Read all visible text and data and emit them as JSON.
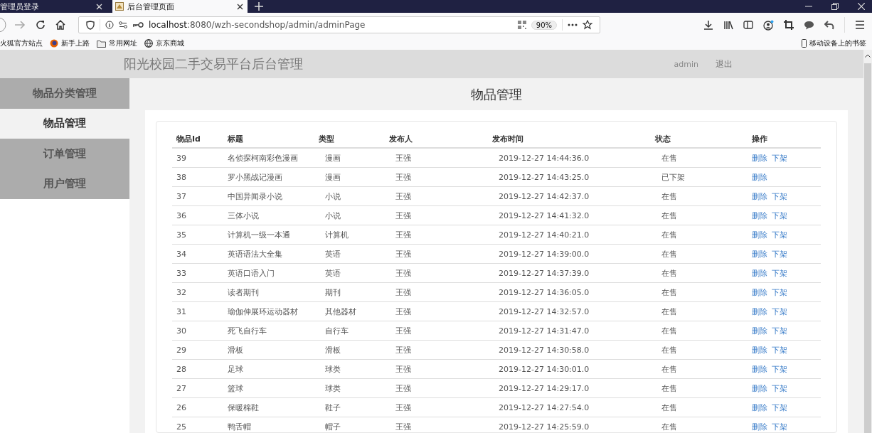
{
  "browser": {
    "tabs": [
      {
        "label": "管理员登录",
        "selected": false
      },
      {
        "label": "后台管理页面",
        "selected": true
      }
    ],
    "url": {
      "host": "localhost",
      "rest": ":8080/wzh-secondshop/admin/adminPage"
    },
    "zoom": "90%",
    "bookmarks": [
      "火狐官方站点",
      "新手上路",
      "常用网址",
      "京东商城"
    ],
    "mobile_bookmarks": "移动设备上的书签"
  },
  "header": {
    "title": "阳光校园二手交易平台后台管理",
    "user": "admin",
    "logout": "退出"
  },
  "sidebar": {
    "items": [
      {
        "label": "物品分类管理",
        "selected": false
      },
      {
        "label": "物品管理",
        "selected": true
      },
      {
        "label": "订单管理",
        "selected": false
      },
      {
        "label": "用户管理",
        "selected": false
      }
    ]
  },
  "page_title": "物品管理",
  "table": {
    "columns": [
      "物品Id",
      "标题",
      "类型",
      "发布人",
      "发布时间",
      "状态",
      "操作"
    ],
    "rows": [
      {
        "id": "39",
        "title": "名侦探柯南彩色漫画",
        "type": "漫画",
        "publisher": "王强",
        "time": "2019-12-27 14:44:36.0",
        "status": "在售",
        "actions": [
          "删除",
          "下架"
        ]
      },
      {
        "id": "38",
        "title": "罗小黑战记漫画",
        "type": "漫画",
        "publisher": "王强",
        "time": "2019-12-27 14:43:25.0",
        "status": "已下架",
        "actions": [
          "删除"
        ]
      },
      {
        "id": "37",
        "title": "中国异闻录小说",
        "type": "小说",
        "publisher": "王强",
        "time": "2019-12-27 14:42:37.0",
        "status": "在售",
        "actions": [
          "删除",
          "下架"
        ]
      },
      {
        "id": "36",
        "title": "三体小说",
        "type": "小说",
        "publisher": "王强",
        "time": "2019-12-27 14:41:32.0",
        "status": "在售",
        "actions": [
          "删除",
          "下架"
        ]
      },
      {
        "id": "35",
        "title": "计算机一级一本通",
        "type": "计算机",
        "publisher": "王强",
        "time": "2019-12-27 14:40:21.0",
        "status": "在售",
        "actions": [
          "删除",
          "下架"
        ]
      },
      {
        "id": "34",
        "title": "英语语法大全集",
        "type": "英语",
        "publisher": "王强",
        "time": "2019-12-27 14:39:00.0",
        "status": "在售",
        "actions": [
          "删除",
          "下架"
        ]
      },
      {
        "id": "33",
        "title": "英语口语入门",
        "type": "英语",
        "publisher": "王强",
        "time": "2019-12-27 14:37:39.0",
        "status": "在售",
        "actions": [
          "删除",
          "下架"
        ]
      },
      {
        "id": "32",
        "title": "读者期刊",
        "type": "期刊",
        "publisher": "王强",
        "time": "2019-12-27 14:36:05.0",
        "status": "在售",
        "actions": [
          "删除",
          "下架"
        ]
      },
      {
        "id": "31",
        "title": "瑜伽伸展环运动器材",
        "type": "其他器材",
        "publisher": "王强",
        "time": "2019-12-27 14:32:57.0",
        "status": "在售",
        "actions": [
          "删除",
          "下架"
        ]
      },
      {
        "id": "30",
        "title": "死飞自行车",
        "type": "自行车",
        "publisher": "王强",
        "time": "2019-12-27 14:31:47.0",
        "status": "在售",
        "actions": [
          "删除",
          "下架"
        ]
      },
      {
        "id": "29",
        "title": "滑板",
        "type": "滑板",
        "publisher": "王强",
        "time": "2019-12-27 14:30:58.0",
        "status": "在售",
        "actions": [
          "删除",
          "下架"
        ]
      },
      {
        "id": "28",
        "title": "足球",
        "type": "球类",
        "publisher": "王强",
        "time": "2019-12-27 14:30:01.0",
        "status": "在售",
        "actions": [
          "删除",
          "下架"
        ]
      },
      {
        "id": "27",
        "title": "篮球",
        "type": "球类",
        "publisher": "王强",
        "time": "2019-12-27 14:29:17.0",
        "status": "在售",
        "actions": [
          "删除",
          "下架"
        ]
      },
      {
        "id": "26",
        "title": "保暖棉鞋",
        "type": "鞋子",
        "publisher": "王强",
        "time": "2019-12-27 14:27:54.0",
        "status": "在售",
        "actions": [
          "删除",
          "下架"
        ]
      },
      {
        "id": "25",
        "title": "鸭舌帽",
        "type": "帽子",
        "publisher": "王强",
        "time": "2019-12-27 14:25:59.0",
        "status": "在售",
        "actions": [
          "删除",
          "下架"
        ]
      }
    ]
  }
}
